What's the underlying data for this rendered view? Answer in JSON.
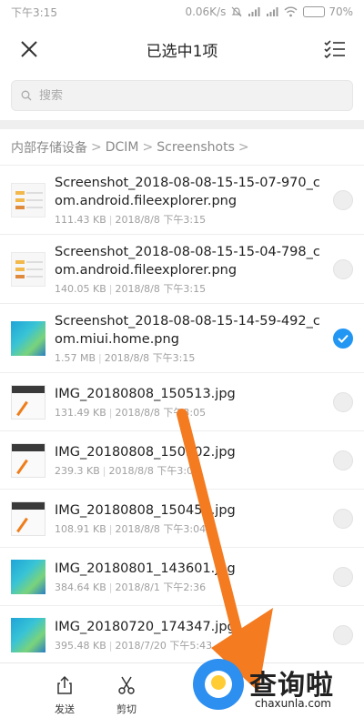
{
  "status_bar": {
    "time": "下午3:15",
    "net_speed": "0.06K/s",
    "battery": "70%",
    "battery_level": 0.7
  },
  "header": {
    "title": "已选中1项",
    "close_icon": "close-icon",
    "select_all_icon": "checklist-icon"
  },
  "search": {
    "placeholder": "搜索"
  },
  "breadcrumb": [
    "内部存储设备",
    "DCIM",
    "Screenshots"
  ],
  "files": [
    {
      "name": "Screenshot_2018-08-08-15-15-07-970_com.android.fileexplorer.png",
      "size": "111.43 KB",
      "date": "2018/8/8 下午3:15",
      "selected": false,
      "thumb": "light"
    },
    {
      "name": "Screenshot_2018-08-08-15-15-04-798_com.android.fileexplorer.png",
      "size": "140.05 KB",
      "date": "2018/8/8 下午3:15",
      "selected": false,
      "thumb": "light"
    },
    {
      "name": "Screenshot_2018-08-08-15-14-59-492_com.miui.home.png",
      "size": "1.57 MB",
      "date": "2018/8/8 下午3:15",
      "selected": true,
      "thumb": "home"
    },
    {
      "name": "IMG_20180808_150513.jpg",
      "size": "131.49 KB",
      "date": "2018/8/8 下午3:05",
      "selected": false,
      "thumb": "img"
    },
    {
      "name": "IMG_20180808_150502.jpg",
      "size": "239.3 KB",
      "date": "2018/8/8 下午3:05",
      "selected": false,
      "thumb": "img"
    },
    {
      "name": "IMG_20180808_150450.jpg",
      "size": "108.91 KB",
      "date": "2018/8/8 下午3:04",
      "selected": false,
      "thumb": "img"
    },
    {
      "name": "IMG_20180801_143601.jpg",
      "size": "384.64 KB",
      "date": "2018/8/1 下午2:36",
      "selected": false,
      "thumb": "home"
    },
    {
      "name": "IMG_20180720_174347.jpg",
      "size": "395.48 KB",
      "date": "2018/7/20 下午5:43",
      "selected": false,
      "thumb": "home"
    }
  ],
  "bottom_actions": [
    {
      "label": "发送",
      "icon": "share-icon"
    },
    {
      "label": "剪切",
      "icon": "scissors-icon"
    }
  ],
  "watermark": {
    "text": "查询啦",
    "domain": "chaxunla.com"
  },
  "colors": {
    "accent": "#2196f3",
    "arrow": "#f47b20"
  }
}
